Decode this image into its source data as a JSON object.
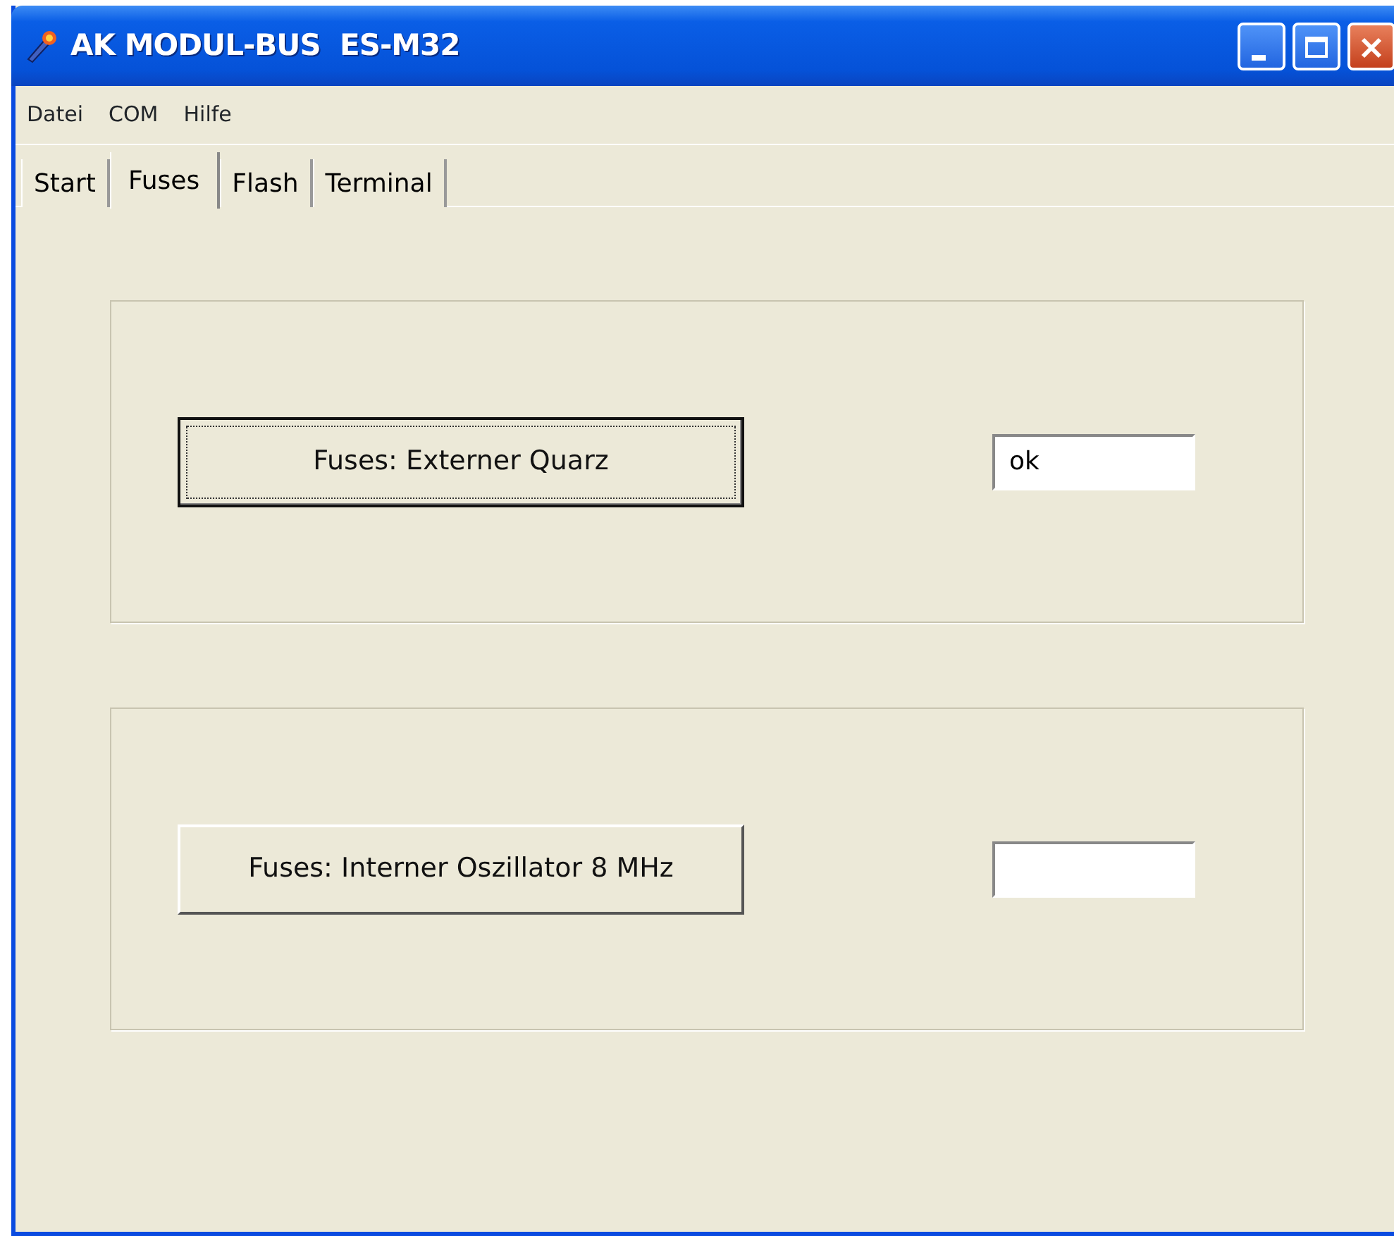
{
  "window": {
    "title": "AK MODUL-BUS  ES-M32"
  },
  "menu": [
    "Datei",
    "COM",
    "Hilfe"
  ],
  "tabs": [
    {
      "label": "Start",
      "selected": false
    },
    {
      "label": "Fuses",
      "selected": true
    },
    {
      "label": "Flash",
      "selected": false
    },
    {
      "label": "Terminal",
      "selected": false
    }
  ],
  "groups": [
    {
      "button": {
        "label": "Fuses: Externer Quarz",
        "focused": true
      },
      "field": {
        "value": "ok"
      }
    },
    {
      "button": {
        "label": "Fuses: Interner Oszillator 8 MHz",
        "focused": false
      }
    }
  ]
}
